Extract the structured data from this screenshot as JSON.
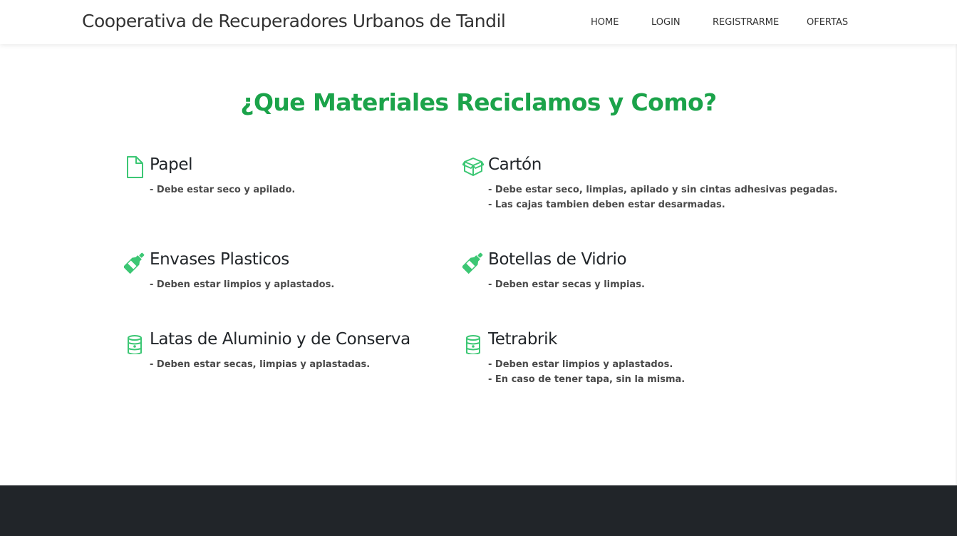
{
  "navbar": {
    "brand": "Cooperativa de Recuperadores Urbanos de Tandil",
    "links": [
      "HOME",
      "LOGIN",
      "REGISTRARME",
      "OFERTAS"
    ]
  },
  "section": {
    "title": "¿Que Materiales Reciclamos y Como?"
  },
  "colors": {
    "accent": "#1ba34a",
    "icon": "#3cc774",
    "footer": "#212529"
  },
  "materials": [
    {
      "icon": "file-icon",
      "name": "Papel",
      "rules": [
        "- Debe estar seco y apilado."
      ]
    },
    {
      "icon": "box-icon",
      "name": "Cartón",
      "rules": [
        "- Debe estar seco, limpias, apilado y sin cintas adhesivas pegadas.",
        "- Las cajas tambien deben estar desarmadas."
      ]
    },
    {
      "icon": "bottle-icon",
      "name": "Envases Plasticos",
      "rules": [
        "- Deben estar limpios y aplastados."
      ]
    },
    {
      "icon": "bottle-icon",
      "name": "Botellas de Vidrio",
      "rules": [
        "- Deben estar secas y limpias."
      ]
    },
    {
      "icon": "can-icon",
      "name": "Latas de Aluminio y de Conserva",
      "rules": [
        "- Deben estar secas, limpias y aplastadas."
      ]
    },
    {
      "icon": "can-icon",
      "name": "Tetrabrik",
      "rules": [
        "- Deben estar limpios y aplastados.",
        "- En caso de tener tapa, sin la misma."
      ]
    }
  ]
}
